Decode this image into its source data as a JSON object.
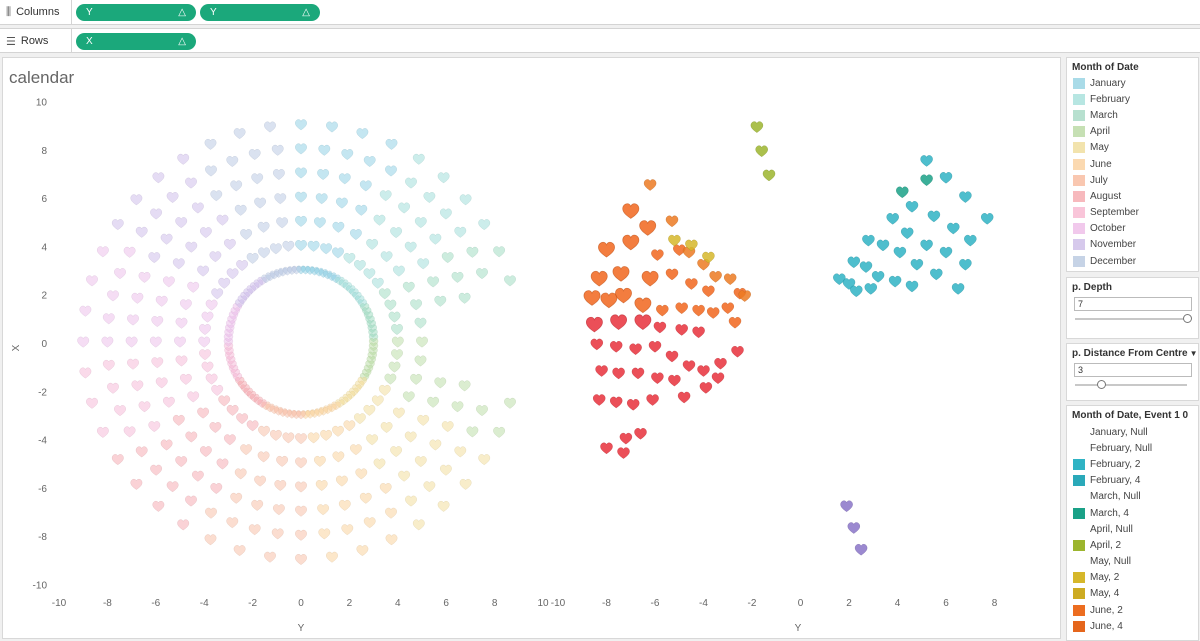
{
  "shelves": {
    "columns": {
      "label": "Columns",
      "icon": "columns-icon",
      "pills": [
        {
          "text": "Y"
        },
        {
          "text": "Y"
        }
      ]
    },
    "rows": {
      "label": "Rows",
      "icon": "rows-icon",
      "pills": [
        {
          "text": "X"
        }
      ]
    },
    "pill_delta": "△",
    "pill_color": "#1ba87b"
  },
  "viz": {
    "title": "calendar",
    "y_axis_label": "X",
    "x_axis_label_left": "Y",
    "x_axis_label_right": "Y"
  },
  "chart_data": [
    {
      "type": "scatter",
      "panel": "left",
      "mark": "heart",
      "xlabel": "Y",
      "ylabel": "X",
      "xlim": [
        -10,
        10
      ],
      "ylim": [
        -10,
        10
      ],
      "x_ticks": [
        -10,
        -8,
        -6,
        -4,
        -2,
        0,
        2,
        4,
        6,
        8,
        10
      ],
      "y_ticks": [
        -10,
        -8,
        -6,
        -4,
        -2,
        0,
        2,
        4,
        6,
        8,
        10
      ],
      "rings": [
        {
          "radius": 3.0,
          "count": 100,
          "size": "small"
        },
        {
          "radius": 4.0,
          "count": 48,
          "size": "medium"
        },
        {
          "radius": 5.0,
          "count": 40,
          "size": "medium"
        },
        {
          "radius": 6.0,
          "count": 44,
          "size": "medium"
        },
        {
          "radius": 7.0,
          "count": 48,
          "size": "medium"
        },
        {
          "radius": 8.0,
          "count": 52,
          "size": "medium"
        },
        {
          "radius": 9.0,
          "count": 44,
          "size": "medium"
        }
      ],
      "ring_gap": {
        "start_deg": -15,
        "end_deg": 15
      },
      "color_by": "Month of Date",
      "opacity": 0.45
    },
    {
      "type": "scatter",
      "panel": "right",
      "mark": "heart",
      "xlabel": "Y",
      "xlim": [
        -10,
        10
      ],
      "x_ticks": [
        -10,
        -8,
        -6,
        -4,
        -2,
        0,
        2,
        4,
        6,
        8
      ],
      "color_by": "Month of Date, Event 1 0",
      "groups": [
        {
          "month": "August",
          "points": [
            [
              -8.0,
              -4.4
            ],
            [
              -7.2,
              -4.0
            ],
            [
              -6.6,
              -3.8
            ],
            [
              -8.3,
              -2.4
            ],
            [
              -7.6,
              -2.5
            ],
            [
              -6.9,
              -2.6
            ],
            [
              -6.1,
              -2.4
            ],
            [
              -8.2,
              -1.2
            ],
            [
              -7.5,
              -1.3
            ],
            [
              -6.7,
              -1.3
            ],
            [
              -5.9,
              -1.5
            ],
            [
              -5.2,
              -1.6
            ],
            [
              -4.8,
              -2.3
            ],
            [
              -8.4,
              -0.1
            ],
            [
              -7.6,
              -0.2
            ],
            [
              -6.8,
              -0.3
            ],
            [
              -6.0,
              -0.2
            ],
            [
              -5.3,
              -0.6
            ],
            [
              -4.6,
              -1.0
            ],
            [
              -4.0,
              -1.2
            ],
            [
              -3.4,
              -1.5
            ],
            [
              -8.5,
              0.7
            ],
            [
              -7.5,
              0.8
            ],
            [
              -6.5,
              0.8
            ],
            [
              -5.8,
              0.6
            ],
            [
              -4.9,
              0.5
            ],
            [
              -4.2,
              0.4
            ],
            [
              -3.3,
              -0.9
            ],
            [
              -2.6,
              -0.4
            ],
            [
              -3.9,
              -1.9
            ],
            [
              -7.3,
              -4.6
            ]
          ]
        },
        {
          "month": "July",
          "points": [
            [
              -8.6,
              1.8
            ],
            [
              -7.9,
              1.7
            ],
            [
              -7.3,
              1.9
            ],
            [
              -6.5,
              1.5
            ],
            [
              -5.7,
              1.3
            ],
            [
              -4.9,
              1.4
            ],
            [
              -4.2,
              1.3
            ],
            [
              -3.6,
              1.2
            ],
            [
              -3.0,
              1.4
            ],
            [
              -8.3,
              2.6
            ],
            [
              -7.4,
              2.8
            ],
            [
              -6.2,
              2.6
            ],
            [
              -5.3,
              2.8
            ],
            [
              -4.5,
              2.4
            ],
            [
              -3.8,
              2.1
            ],
            [
              -8.0,
              3.8
            ],
            [
              -7.0,
              4.1
            ],
            [
              -5.9,
              3.6
            ],
            [
              -5.0,
              3.8
            ],
            [
              -7.0,
              5.4
            ],
            [
              -6.3,
              4.7
            ],
            [
              -2.7,
              0.8
            ],
            [
              -2.5,
              2.0
            ]
          ]
        },
        {
          "month": "June",
          "points": [
            [
              -6.2,
              6.5
            ],
            [
              -5.3,
              5.0
            ],
            [
              -4.6,
              3.7
            ],
            [
              -4.0,
              3.2
            ],
            [
              -3.5,
              2.7
            ],
            [
              -2.9,
              2.6
            ],
            [
              -2.3,
              1.9
            ]
          ]
        },
        {
          "month": "May",
          "points": [
            [
              -5.2,
              4.2
            ],
            [
              -4.5,
              4.0
            ],
            [
              -3.8,
              3.5
            ]
          ]
        },
        {
          "month": "April",
          "points": [
            [
              -1.8,
              8.9
            ],
            [
              -1.6,
              7.9
            ],
            [
              -1.3,
              6.9
            ]
          ]
        },
        {
          "month": "March",
          "points": [
            [
              4.2,
              6.2
            ],
            [
              5.2,
              6.7
            ]
          ]
        },
        {
          "month": "February",
          "points": [
            [
              5.2,
              7.5
            ],
            [
              6.0,
              6.8
            ],
            [
              6.8,
              6.0
            ],
            [
              7.7,
              5.1
            ],
            [
              4.6,
              5.6
            ],
            [
              5.5,
              5.2
            ],
            [
              6.3,
              4.7
            ],
            [
              7.0,
              4.2
            ],
            [
              3.8,
              5.1
            ],
            [
              4.4,
              4.5
            ],
            [
              5.2,
              4.0
            ],
            [
              6.0,
              3.7
            ],
            [
              6.8,
              3.2
            ],
            [
              2.8,
              4.2
            ],
            [
              3.4,
              4.0
            ],
            [
              4.1,
              3.7
            ],
            [
              4.8,
              3.2
            ],
            [
              5.6,
              2.8
            ],
            [
              6.5,
              2.2
            ],
            [
              2.2,
              3.3
            ],
            [
              2.7,
              3.1
            ],
            [
              3.2,
              2.7
            ],
            [
              3.9,
              2.5
            ],
            [
              4.6,
              2.3
            ],
            [
              1.6,
              2.6
            ],
            [
              2.0,
              2.4
            ],
            [
              2.3,
              2.1
            ],
            [
              2.9,
              2.2
            ]
          ]
        },
        {
          "month": "November",
          "points": [
            [
              1.9,
              -6.8
            ],
            [
              2.2,
              -7.7
            ],
            [
              2.5,
              -8.6
            ]
          ]
        }
      ]
    }
  ],
  "legend_month": {
    "title": "Month of Date",
    "items": [
      {
        "label": "January",
        "color": "#a9dbe8"
      },
      {
        "label": "February",
        "color": "#b7e6e2"
      },
      {
        "label": "March",
        "color": "#b7e0cf"
      },
      {
        "label": "April",
        "color": "#c6e0b4"
      },
      {
        "label": "May",
        "color": "#f2e3ad"
      },
      {
        "label": "June",
        "color": "#fbd9b0"
      },
      {
        "label": "July",
        "color": "#f9c7b0"
      },
      {
        "label": "August",
        "color": "#f7b9bd"
      },
      {
        "label": "September",
        "color": "#f9c5d9"
      },
      {
        "label": "October",
        "color": "#f1c9ec"
      },
      {
        "label": "November",
        "color": "#d6c9ec"
      },
      {
        "label": "December",
        "color": "#c6d3e6"
      }
    ]
  },
  "param_depth": {
    "title": "p. Depth",
    "value": "7",
    "level": 1.0
  },
  "param_distance": {
    "title": "p. Distance From Centre",
    "value": "3",
    "level": 0.2
  },
  "legend_events": {
    "title": "Month of Date, Event 1 0",
    "items": [
      {
        "label": "January, Null",
        "color": ""
      },
      {
        "label": "February, Null",
        "color": ""
      },
      {
        "label": "February, 2",
        "color": "#2fb3c4"
      },
      {
        "label": "February, 4",
        "color": "#2aa9b9"
      },
      {
        "label": "March, Null",
        "color": ""
      },
      {
        "label": "March, 4",
        "color": "#1aa187"
      },
      {
        "label": "April, Null",
        "color": ""
      },
      {
        "label": "April, 2",
        "color": "#9cb52e"
      },
      {
        "label": "May, Null",
        "color": ""
      },
      {
        "label": "May, 2",
        "color": "#d6b72a"
      },
      {
        "label": "May, 4",
        "color": "#cdab22"
      },
      {
        "label": "June, 2",
        "color": "#ec6d20"
      },
      {
        "label": "June, 4",
        "color": "#e5661c"
      }
    ]
  },
  "colors": {
    "event_february": "#2fb3c4",
    "event_march": "#1aa187",
    "event_april": "#9cb52e",
    "event_may": "#d6b72a",
    "event_june": "#ec7a22",
    "event_july": "#f1661d",
    "event_august": "#e8303b",
    "event_november": "#8a74c8"
  }
}
